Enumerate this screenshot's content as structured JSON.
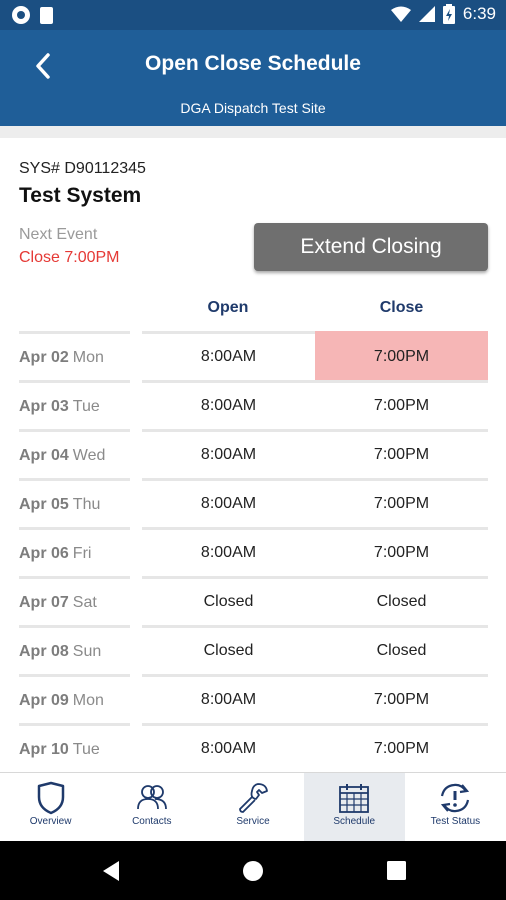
{
  "status_bar": {
    "time": "6:39",
    "icons": [
      "circle-icon",
      "sim-card-icon",
      "wifi-icon",
      "signal-icon",
      "battery-icon"
    ]
  },
  "header": {
    "title": "Open Close Schedule",
    "subtitle": "DGA Dispatch Test Site",
    "back_icon": "chevron-left-icon",
    "background": "#1f5e98"
  },
  "system": {
    "number": "SYS# D90112345",
    "name": "Test System"
  },
  "next_event": {
    "label": "Next Event",
    "value": "Close 7:00PM",
    "value_color": "#e53935"
  },
  "extend_button": {
    "label": "Extend Closing"
  },
  "schedule": {
    "columns": {
      "open": "Open",
      "close": "Close"
    },
    "highlight_color": "#f6b6b6",
    "rows": [
      {
        "date": "Apr 02",
        "day": "Mon",
        "open": "8:00AM",
        "close": "7:00PM",
        "highlight_close": true
      },
      {
        "date": "Apr 03",
        "day": "Tue",
        "open": "8:00AM",
        "close": "7:00PM",
        "highlight_close": false
      },
      {
        "date": "Apr 04",
        "day": "Wed",
        "open": "8:00AM",
        "close": "7:00PM",
        "highlight_close": false
      },
      {
        "date": "Apr 05",
        "day": "Thu",
        "open": "8:00AM",
        "close": "7:00PM",
        "highlight_close": false
      },
      {
        "date": "Apr 06",
        "day": "Fri",
        "open": "8:00AM",
        "close": "7:00PM",
        "highlight_close": false
      },
      {
        "date": "Apr 07",
        "day": "Sat",
        "open": "Closed",
        "close": "Closed",
        "highlight_close": false
      },
      {
        "date": "Apr 08",
        "day": "Sun",
        "open": "Closed",
        "close": "Closed",
        "highlight_close": false
      },
      {
        "date": "Apr 09",
        "day": "Mon",
        "open": "8:00AM",
        "close": "7:00PM",
        "highlight_close": false
      },
      {
        "date": "Apr 10",
        "day": "Tue",
        "open": "8:00AM",
        "close": "7:00PM",
        "highlight_close": false
      }
    ]
  },
  "bottom_nav": {
    "items": [
      {
        "label": "Overview",
        "icon": "shield-icon",
        "active": false
      },
      {
        "label": "Contacts",
        "icon": "contacts-icon",
        "active": false
      },
      {
        "label": "Service",
        "icon": "wrench-icon",
        "active": false
      },
      {
        "label": "Schedule",
        "icon": "calendar-icon",
        "active": true
      },
      {
        "label": "Test Status",
        "icon": "test-status-icon",
        "active": false
      }
    ]
  }
}
